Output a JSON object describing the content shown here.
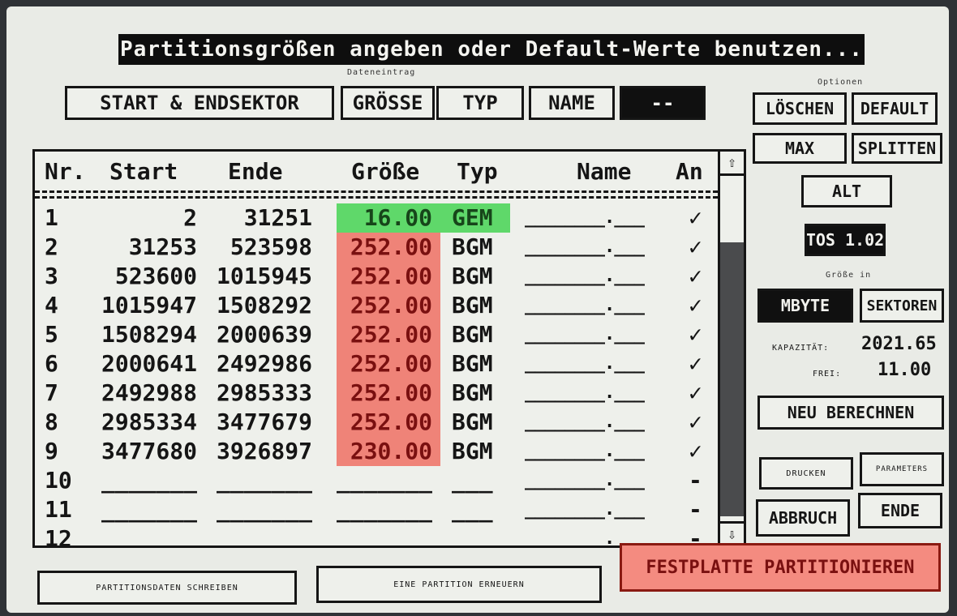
{
  "title": "Partitionsgrößen angeben oder Default-Werte benutzen...",
  "entry_caption": "Dateneintrag",
  "options_caption": "Optionen",
  "entry_buttons": {
    "start_end": "START & ENDSEKTOR",
    "size": "GRÖSSE",
    "type": "TYP",
    "name": "NAME",
    "dash": "--"
  },
  "columns": {
    "nr": "Nr.",
    "start": "Start",
    "end": "Ende",
    "size": "Größe",
    "type": "Typ",
    "name": "Name",
    "on": "An"
  },
  "rows": [
    {
      "nr": "1",
      "start": "2",
      "end": "31251",
      "size": "16.00",
      "type": "GEM",
      "name": "________.___",
      "on": "✓",
      "color": "green"
    },
    {
      "nr": "2",
      "start": "31253",
      "end": "523598",
      "size": "252.00",
      "type": "BGM",
      "name": "________.___",
      "on": "✓",
      "color": "red"
    },
    {
      "nr": "3",
      "start": "523600",
      "end": "1015945",
      "size": "252.00",
      "type": "BGM",
      "name": "________.___",
      "on": "✓",
      "color": "red"
    },
    {
      "nr": "4",
      "start": "1015947",
      "end": "1508292",
      "size": "252.00",
      "type": "BGM",
      "name": "________.___",
      "on": "✓",
      "color": "red"
    },
    {
      "nr": "5",
      "start": "1508294",
      "end": "2000639",
      "size": "252.00",
      "type": "BGM",
      "name": "________.___",
      "on": "✓",
      "color": "red"
    },
    {
      "nr": "6",
      "start": "2000641",
      "end": "2492986",
      "size": "252.00",
      "type": "BGM",
      "name": "________.___",
      "on": "✓",
      "color": "red"
    },
    {
      "nr": "7",
      "start": "2492988",
      "end": "2985333",
      "size": "252.00",
      "type": "BGM",
      "name": "________.___",
      "on": "✓",
      "color": "red"
    },
    {
      "nr": "8",
      "start": "2985334",
      "end": "3477679",
      "size": "252.00",
      "type": "BGM",
      "name": "________.___",
      "on": "✓",
      "color": "red"
    },
    {
      "nr": "9",
      "start": "3477680",
      "end": "3926897",
      "size": "230.00",
      "type": "BGM",
      "name": "________.___",
      "on": "✓",
      "color": "red"
    },
    {
      "nr": "10",
      "start": "_______",
      "end": "_______",
      "size": "_______",
      "type": "___",
      "name": "________.___",
      "on": "-",
      "color": "none"
    },
    {
      "nr": "11",
      "start": "_______",
      "end": "_______",
      "size": "_______",
      "type": "___",
      "name": "________.___",
      "on": "-",
      "color": "none"
    },
    {
      "nr": "12",
      "start": "_______",
      "end": "_______",
      "size": "_______",
      "type": "___",
      "name": "________.___",
      "on": "-",
      "color": "none"
    }
  ],
  "options": {
    "loeschen": "LÖSCHEN",
    "default": "DEFAULT",
    "max": "MAX",
    "splitten": "SPLITTEN",
    "alt": "ALT",
    "tos": "TOS 1.02",
    "size_in_caption": "Größe in",
    "mbyte": "MBYTE",
    "sektoren": "SEKTOREN",
    "capacity_label": "KAPAZITÄT:",
    "capacity_value": "2021.65",
    "free_label": "FREI:",
    "free_value": "11.00",
    "recalc": "NEU BERECHNEN",
    "drucken": "DRUCKEN",
    "parameter": "PARAMETERS",
    "abbruch": "ABBRUCH",
    "ende": "ENDE"
  },
  "bottom": {
    "write": "PARTITIONSDATEN SCHREIBEN",
    "renew": "EINE PARTITION ERNEUERN",
    "partition": "FESTPLATTE PARTITIONIEREN"
  },
  "colors": {
    "green": "#5fd86a",
    "red": "#ef8378",
    "partition_button": "#f48b80"
  }
}
